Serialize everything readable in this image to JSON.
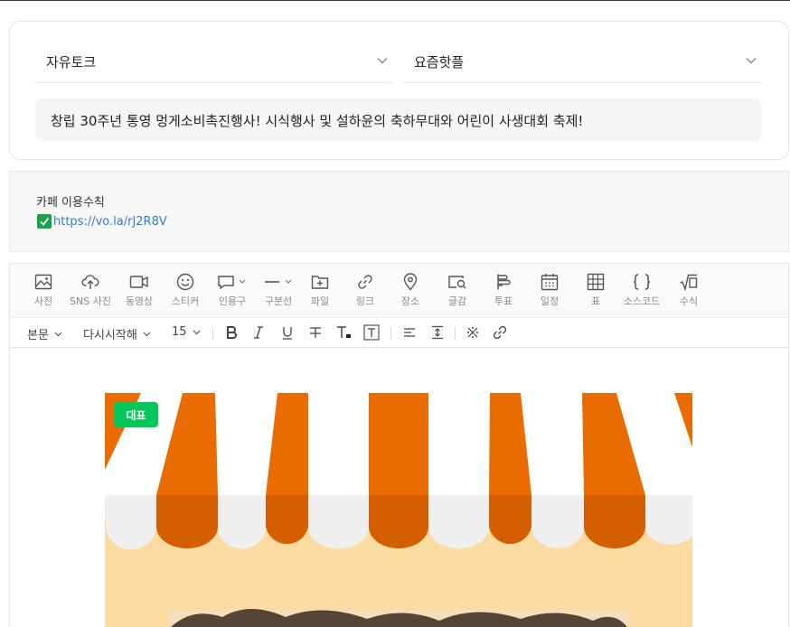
{
  "post": {
    "board": "자유토크",
    "head": "요즘핫플",
    "title": "창립 30주년 통영 멍게소비촉진행사! 시식행사 및 설하윤의 축하무대와 어린이 사생대회 축제!"
  },
  "rules": {
    "label": "카페 이용수칙",
    "link": "https://vo.la/rJ2R8V"
  },
  "toolbar": {
    "tools": [
      {
        "label": "사진",
        "icon": "photo-icon"
      },
      {
        "label": "SNS 사진",
        "icon": "cloud-upload-icon"
      },
      {
        "label": "동영상",
        "icon": "video-icon"
      },
      {
        "label": "스티커",
        "icon": "sticker-icon"
      },
      {
        "label": "인용구",
        "icon": "quote-icon"
      },
      {
        "label": "구분선",
        "icon": "divider-icon"
      },
      {
        "label": "파일",
        "icon": "file-icon"
      },
      {
        "label": "링크",
        "icon": "link-icon"
      },
      {
        "label": "장소",
        "icon": "location-icon"
      },
      {
        "label": "글감",
        "icon": "material-search-icon"
      },
      {
        "label": "투표",
        "icon": "vote-icon"
      },
      {
        "label": "일정",
        "icon": "calendar-icon"
      },
      {
        "label": "표",
        "icon": "table-icon"
      },
      {
        "label": "소스코드",
        "icon": "code-icon"
      },
      {
        "label": "수식",
        "icon": "formula-icon"
      }
    ]
  },
  "format": {
    "paragraph_style": "본문",
    "font": "다시시작해",
    "size": "15"
  },
  "content": {
    "badge": "대표"
  },
  "colors": {
    "badge": "#03c75a",
    "awning_orange": "#ea6c00",
    "awning_shadow": "#d35f00",
    "banner_bg": "#fcdba3",
    "link": "#2f7bd9"
  }
}
